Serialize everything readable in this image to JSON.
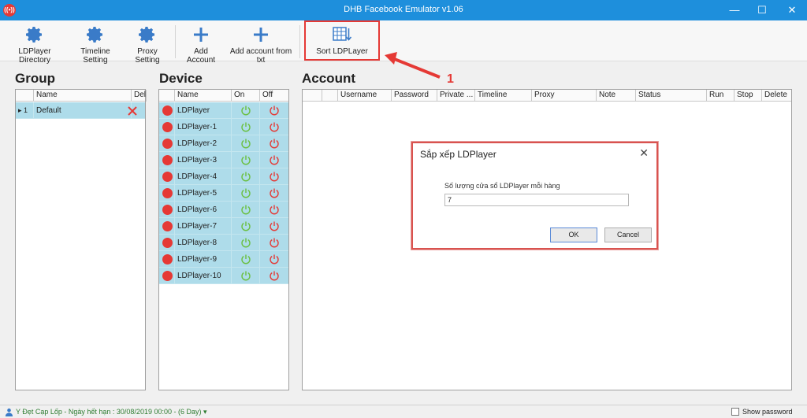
{
  "window": {
    "title": "DHB Facebook Emulator v1.06",
    "minimize": "—",
    "maximize": "☐",
    "close": "✕"
  },
  "toolbar": {
    "ldplayer_directory": "LDPlayer Directory",
    "timeline_setting": "Timeline Setting",
    "proxy_setting": "Proxy Setting",
    "add_account": "Add Account",
    "add_account_txt": "Add account from txt",
    "sort_ldplayer": "Sort LDPLayer"
  },
  "annotation": {
    "number": "1"
  },
  "group": {
    "title": "Group",
    "columns": [
      "Name",
      "Delete"
    ],
    "rows": [
      {
        "index": "1",
        "name": "Default"
      }
    ]
  },
  "device": {
    "title": "Device",
    "columns": [
      "Name",
      "On",
      "Off"
    ],
    "rows": [
      "LDPlayer",
      "LDPlayer-1",
      "LDPlayer-2",
      "LDPlayer-3",
      "LDPlayer-4",
      "LDPlayer-5",
      "LDPlayer-6",
      "LDPlayer-7",
      "LDPlayer-8",
      "LDPlayer-9",
      "LDPlayer-10"
    ]
  },
  "account": {
    "title": "Account",
    "columns": [
      "Username",
      "Password",
      "Private ...",
      "Timeline",
      "Proxy",
      "Note",
      "Status",
      "Run",
      "Stop",
      "Delete"
    ]
  },
  "dialog": {
    "title": "Sắp xếp LDPlayer",
    "label": "Số lượng cửa sổ LDPlayer mỗi hàng",
    "value": "7",
    "ok": "OK",
    "cancel": "Cancel"
  },
  "status": {
    "text": "Y Đẹt Cạp Lốp - Ngày hết hạn : 30/08/2019 00:00 - (6 Day) ▾",
    "show_password": "Show password"
  },
  "colors": {
    "titlebar": "#1e8fdc",
    "row": "#aedcea",
    "on": "#6abf40",
    "off": "#e53935",
    "accent": "#3a7bc8"
  }
}
